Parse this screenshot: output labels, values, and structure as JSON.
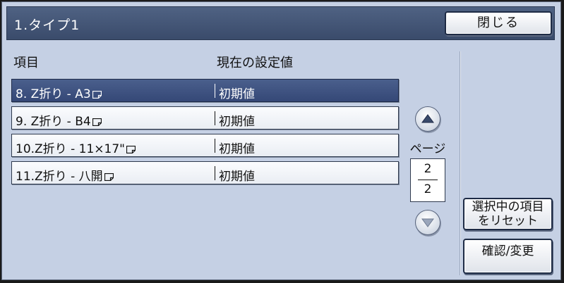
{
  "title_bar": {
    "title": "1.タイプ1",
    "close_label": "閉じる"
  },
  "columns": {
    "item": "項目",
    "value": "現在の設定値"
  },
  "rows": [
    {
      "label": "8. Z折り - A3",
      "value": "初期値",
      "selected": true
    },
    {
      "label": "9. Z折り - B4",
      "value": "初期値",
      "selected": false
    },
    {
      "label": "10.Z折り - 11×17\"",
      "value": "初期値",
      "selected": false
    },
    {
      "label": "11.Z折り - 八開",
      "value": "初期値",
      "selected": false
    }
  ],
  "pagination": {
    "label": "ページ",
    "current": "2",
    "total": "2"
  },
  "side_buttons": {
    "reset_line1": "選択中の項目",
    "reset_line2": "をリセット",
    "confirm_label": "確認/変更"
  },
  "icons": {
    "paper": "paper-landscape-icon",
    "up": "triangle-up-icon",
    "down": "triangle-down-icon"
  },
  "colors": {
    "background": "#c5d0e4",
    "title_bar": "#3a4b6b",
    "selected_row": "#354877"
  }
}
